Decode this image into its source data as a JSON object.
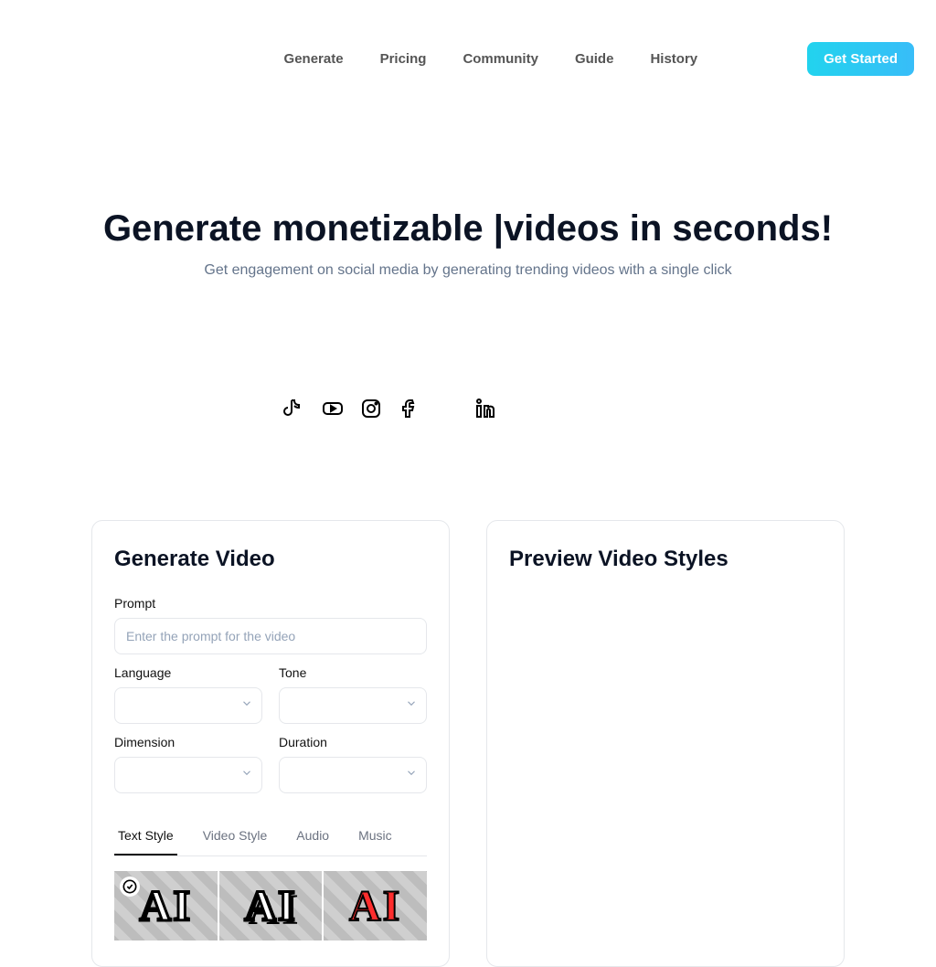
{
  "header": {
    "nav": [
      "Generate",
      "Pricing",
      "Community",
      "Guide",
      "History"
    ],
    "cta": "Get Started"
  },
  "hero": {
    "title_prefix": "Generate monetizable ",
    "title_suffix": "videos in seconds!",
    "cursor": "|",
    "subtitle": "Get engagement on social media by generating trending videos with a single click"
  },
  "socials": [
    "tiktok",
    "youtube",
    "instagram",
    "facebook",
    "spacer",
    "linkedin"
  ],
  "generate": {
    "title": "Generate Video",
    "prompt_label": "Prompt",
    "prompt_placeholder": "Enter the prompt for the video",
    "language_label": "Language",
    "tone_label": "Tone",
    "dimension_label": "Dimension",
    "duration_label": "Duration",
    "tabs": [
      "Text Style",
      "Video Style",
      "Audio",
      "Music"
    ],
    "active_tab_index": 0,
    "thumb_label": "AI"
  },
  "preview": {
    "title": "Preview Video Styles"
  }
}
